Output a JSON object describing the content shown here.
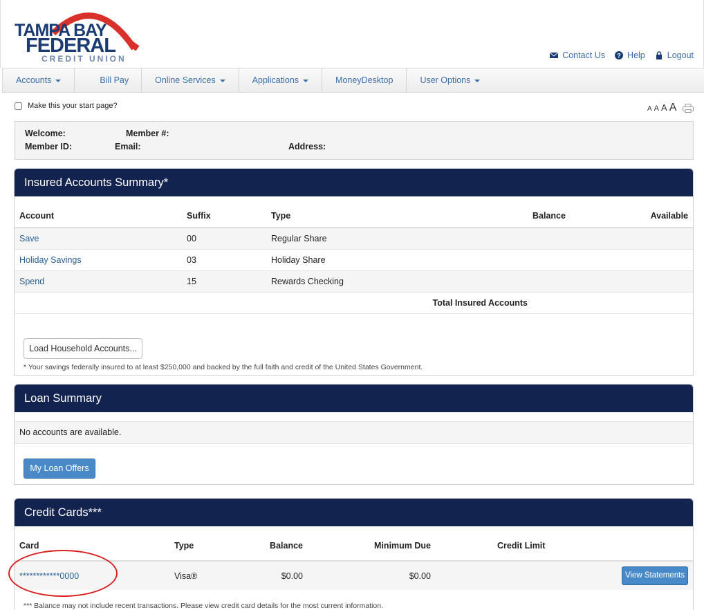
{
  "brand": {
    "line1": "TAMPA BAY",
    "line2": "FEDERAL",
    "line3": "CREDIT UNION",
    "arc_color": "#d8302a",
    "text_color": "#1a3b73"
  },
  "top_links": {
    "contact": "Contact Us",
    "help": "Help",
    "logout": "Logout"
  },
  "nav": {
    "items": [
      {
        "label": "Accounts"
      },
      {
        "label": "Bill Pay"
      },
      {
        "label": "Online Services"
      },
      {
        "label": "Applications"
      },
      {
        "label": "MoneyDesktop"
      },
      {
        "label": "User Options"
      }
    ]
  },
  "start_page": {
    "label": "Make this your start page?",
    "checked": false
  },
  "font_size_controls": [
    "A",
    "A",
    "A",
    "A"
  ],
  "member_info": {
    "welcome_label": "Welcome:",
    "member_num_label": "Member #:",
    "member_id_label": "Member ID:",
    "email_label": "Email:",
    "address_label": "Address:"
  },
  "insured": {
    "title": "Insured Accounts Summary*",
    "columns": {
      "account": "Account",
      "suffix": "Suffix",
      "type": "Type",
      "balance": "Balance",
      "available": "Available"
    },
    "rows": [
      {
        "account": "Save",
        "suffix": "00",
        "type": "Regular Share"
      },
      {
        "account": "Holiday Savings",
        "suffix": "03",
        "type": "Holiday Share"
      },
      {
        "account": "Spend",
        "suffix": "15",
        "type": "Rewards Checking"
      }
    ],
    "total_label": "Total Insured Accounts",
    "load_button": "Load Household Accounts...",
    "footnote": "* Your savings federally insured to at least $250,000 and backed by the full faith and credit of the United States Government."
  },
  "loan": {
    "title": "Loan Summary",
    "empty_text": "No accounts are available.",
    "offers_button": "My Loan Offers"
  },
  "credit_cards": {
    "title": "Credit Cards***",
    "columns": {
      "card": "Card",
      "type": "Type",
      "balance": "Balance",
      "minimum_due": "Minimum Due",
      "credit_limit": "Credit Limit"
    },
    "rows": [
      {
        "card": "************0000",
        "type": "Visa®",
        "balance": "$0.00",
        "minimum_due": "$0.00",
        "action": "View Statements"
      }
    ],
    "footnote": "*** Balance may not include recent transactions. Please view credit card details for the most current information."
  },
  "colors": {
    "panel_header": "#13234f",
    "link": "#2b5f95",
    "primary_button": "#4a89c8",
    "annotation": "#d82020"
  }
}
